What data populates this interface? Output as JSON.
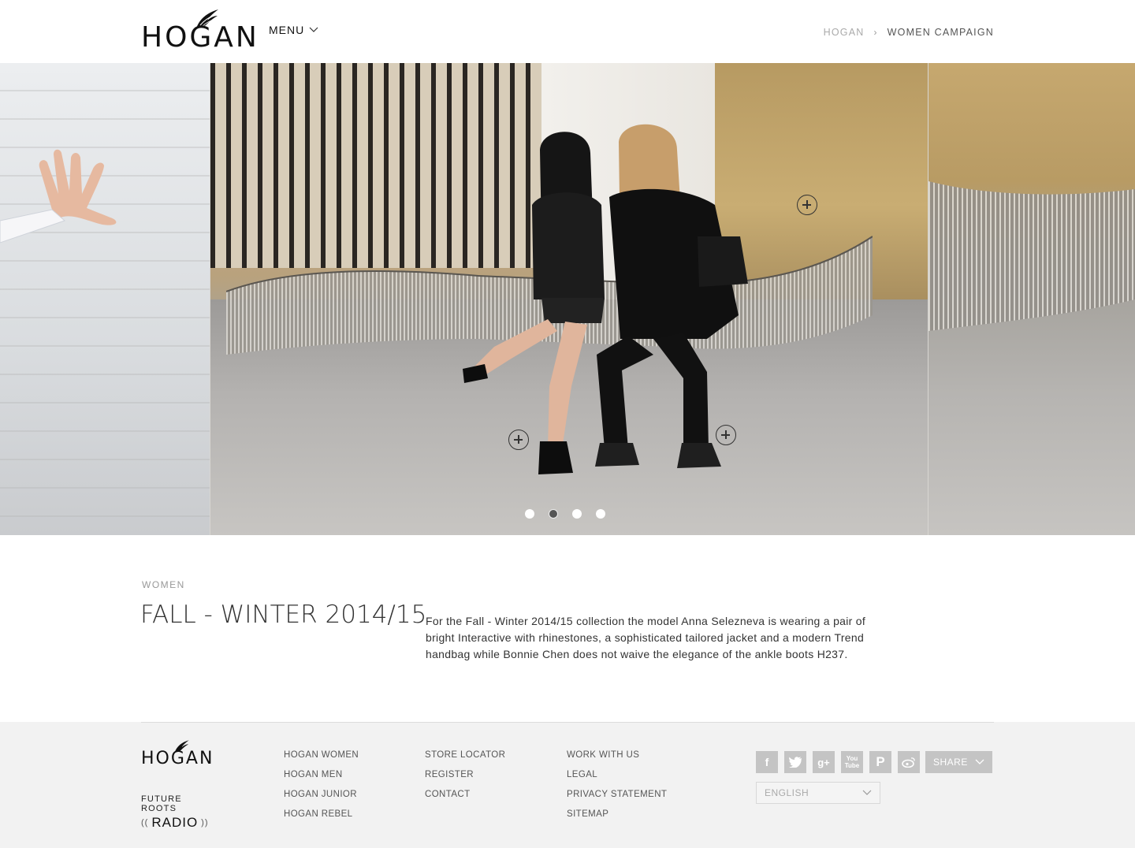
{
  "header": {
    "logo_text": "HOGAN",
    "menu_label": "MENU",
    "breadcrumb": {
      "home": "HOGAN",
      "current": "WOMEN CAMPAIGN"
    }
  },
  "carousel": {
    "slide_count": 4,
    "active_index": 1
  },
  "content": {
    "section_label": "WOMEN",
    "title": "FALL - WINTER 2014/15",
    "description": "For the  Fall - Winter 2014/15 collection the model Anna Selezneva is wearing a pair of bright Interactive with rhinestones, a sophisticated tailored jacket and a modern Trend handbag  while Bonnie Chen does not waive the elegance of the ankle boots H237."
  },
  "footer": {
    "logo_text": "HOGAN",
    "radio": {
      "top": "FUTURE ROOTS",
      "bottom": "RADIO"
    },
    "col1": [
      "HOGAN WOMEN",
      "HOGAN MEN",
      "HOGAN JUNIOR",
      "HOGAN REBEL"
    ],
    "col2": [
      "STORE LOCATOR",
      "REGISTER",
      "CONTACT"
    ],
    "col3": [
      "WORK WITH US",
      "LEGAL",
      "PRIVACY STATEMENT",
      "SITEMAP"
    ],
    "social_icons": [
      "facebook-icon",
      "twitter-icon",
      "google-plus-icon",
      "youtube-icon",
      "pinterest-icon",
      "weibo-icon"
    ],
    "share_label": "SHARE",
    "language": "ENGLISH"
  },
  "colors": {
    "social_bg": "#c4c4c4",
    "footer_bg": "#f2f2f2",
    "text_muted": "#999999"
  }
}
